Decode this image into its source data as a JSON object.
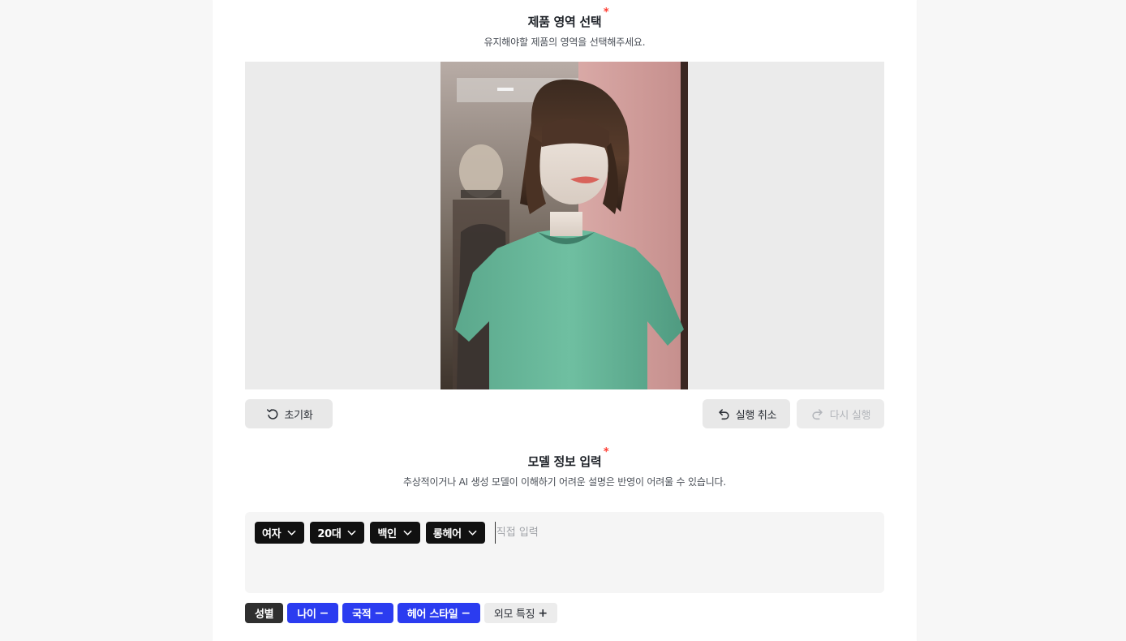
{
  "product_section": {
    "title": "제품 영역 선택",
    "required_mark": "*",
    "description": "유지해야할 제품의 영역을 선택해주세요."
  },
  "toolbar": {
    "reset_label": "초기화",
    "undo_label": "실행 취소",
    "redo_label": "다시 실행"
  },
  "model_section": {
    "title": "모델 정보 입력",
    "required_mark": "*",
    "description": "추상적이거나 AI 생성 모델이 이해하기 어려운 설명은 반영이 어려울 수 있습니다."
  },
  "model_input": {
    "chips": [
      {
        "label": "여자"
      },
      {
        "label": "20대"
      },
      {
        "label": "백인"
      },
      {
        "label": "롱헤어"
      }
    ],
    "placeholder": "직접 입력",
    "value": ""
  },
  "tags": [
    {
      "label": "성별",
      "symbol": "",
      "state": "dark"
    },
    {
      "label": "나이",
      "symbol": "−",
      "state": "active"
    },
    {
      "label": "국적",
      "symbol": "−",
      "state": "active"
    },
    {
      "label": "헤어 스타일",
      "symbol": "−",
      "state": "active"
    },
    {
      "label": "외모 특징",
      "symbol": "+",
      "state": "inactive"
    }
  ],
  "colors": {
    "accent_blue": "#2b3cf0",
    "chip_black": "#111111",
    "required_red": "#ff3b30",
    "canvas_bg": "#ebebeb"
  }
}
